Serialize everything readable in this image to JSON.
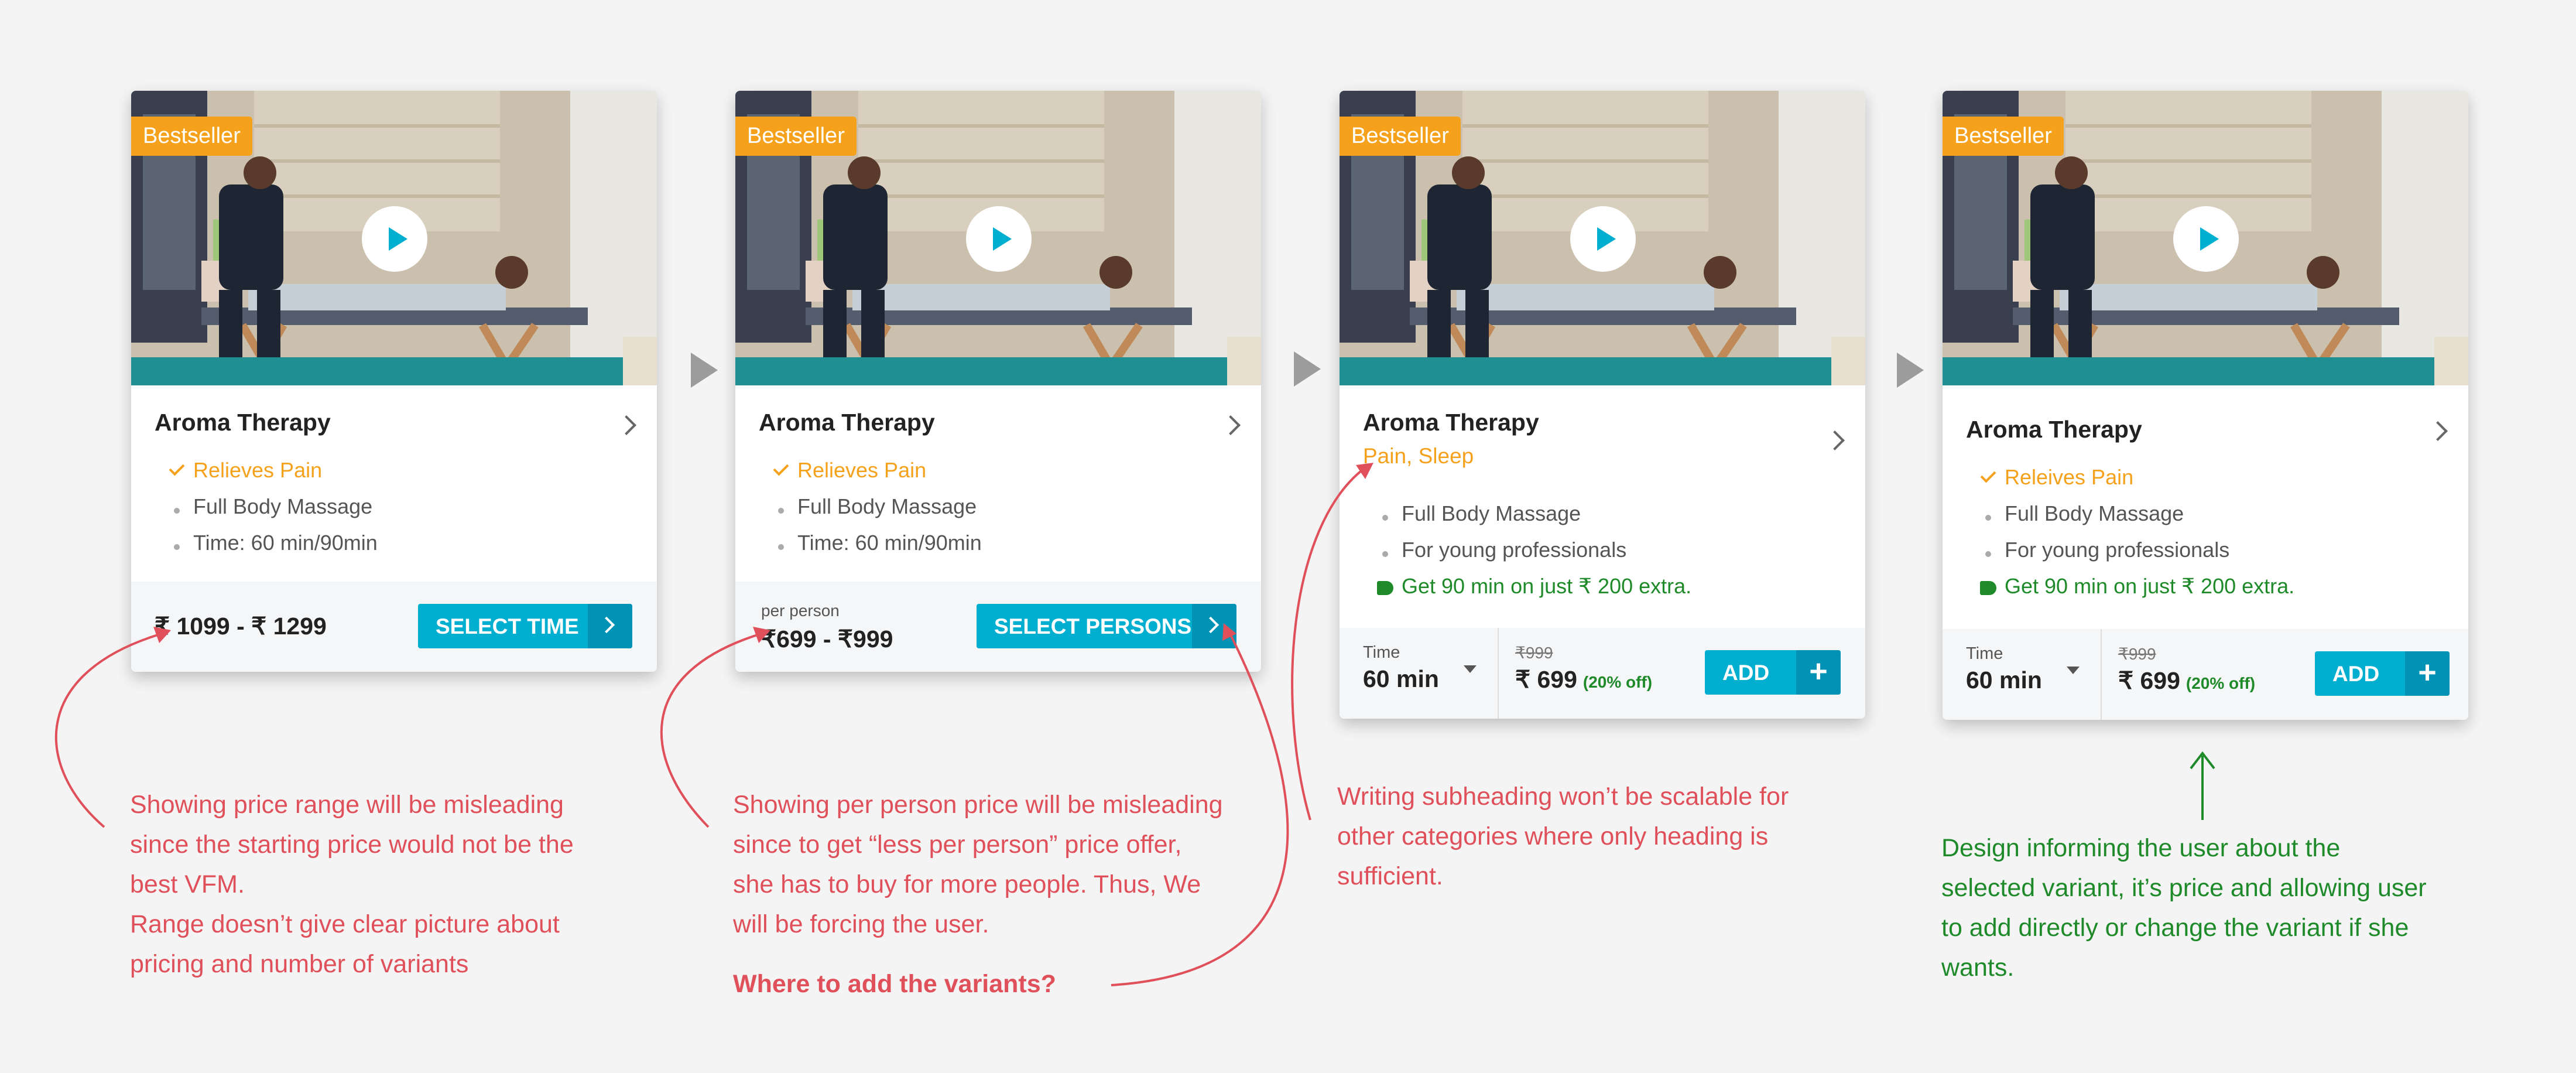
{
  "cards": [
    {
      "badge": "Bestseller",
      "title": "Aroma Therapy",
      "features": [
        {
          "marker": "check",
          "text": "Relieves Pain"
        },
        {
          "marker": "dot",
          "text": "Full Body Massage"
        },
        {
          "marker": "dot",
          "text": "Time: 60 min/90min"
        }
      ],
      "price_range": "₹ 1099 - ₹ 1299",
      "button": "SELECT TIME"
    },
    {
      "badge": "Bestseller",
      "title": "Aroma Therapy",
      "features": [
        {
          "marker": "check",
          "text": "Relieves Pain"
        },
        {
          "marker": "dot",
          "text": "Full Body Massage"
        },
        {
          "marker": "dot",
          "text": "Time: 60 min/90min"
        }
      ],
      "per_person_label": "per person",
      "price_range": "₹699 - ₹999",
      "button": "SELECT PERSONS"
    },
    {
      "badge": "Bestseller",
      "title": "Aroma Therapy",
      "subheading": "Pain, Sleep",
      "features": [
        {
          "marker": "dot",
          "text": "Full Body Massage"
        },
        {
          "marker": "dot",
          "text": "For young professionals"
        },
        {
          "marker": "tag",
          "text": "Get 90 min on just ₹ 200 extra."
        }
      ],
      "time_label": "Time",
      "time_value": "60 min",
      "original_price": "₹999",
      "price": "₹ 699",
      "discount": "(20% off)",
      "button": "ADD"
    },
    {
      "badge": "Bestseller",
      "title": "Aroma Therapy",
      "features": [
        {
          "marker": "check",
          "text": "Releives Pain"
        },
        {
          "marker": "dot",
          "text": "Full Body Massage"
        },
        {
          "marker": "dot",
          "text": "For young professionals"
        },
        {
          "marker": "tag",
          "text": "Get 90 min on just ₹ 200 extra."
        }
      ],
      "time_label": "Time",
      "time_value": "60 min",
      "original_price": "₹999",
      "price": "₹ 699",
      "discount": "(20% off)",
      "button": "ADD"
    }
  ],
  "annotations": {
    "a1": [
      "Showing price range will be misleading",
      "since the starting price would not be the",
      "best VFM.",
      "Range doesn’t give clear picture about",
      "pricing and number of variants"
    ],
    "a2": [
      "Showing per person price will be misleading",
      "since to get “less per person” price offer,",
      "she has to buy for more people. Thus, We",
      "will be forcing the user."
    ],
    "a2_question": "Where to add the variants?",
    "a3": [
      "Writing subheading won’t be scalable for",
      "other categories where only heading is",
      "sufficient."
    ],
    "a4": [
      "Design informing the user about the",
      "selected variant, it’s price and allowing user",
      "to add directly or change the variant if she",
      "wants."
    ]
  },
  "colors": {
    "annotation_red": "#e0505a",
    "annotation_green": "#1f8a2a",
    "accent": "#00aed0",
    "badge": "#f5a11b"
  },
  "icons": [
    "play-icon",
    "chevron-right-icon",
    "check-icon",
    "bullet-dot-icon",
    "tag-icon",
    "dropdown-caret-icon",
    "plus-icon",
    "flow-arrow-icon"
  ]
}
